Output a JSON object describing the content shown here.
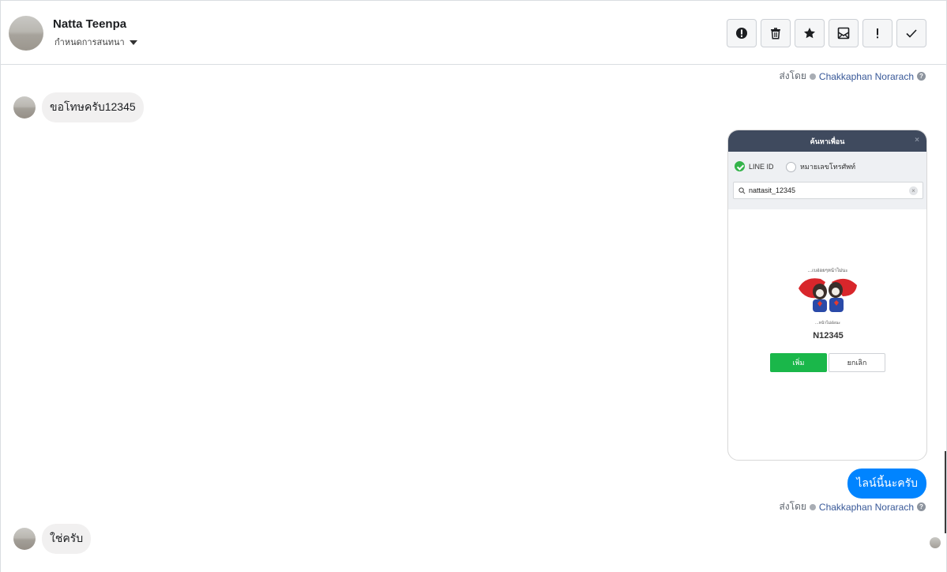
{
  "header": {
    "name": "Natta Teenpa",
    "subtitle": "กำหนดการสนทนา"
  },
  "actions": [
    {
      "name": "spam-button",
      "icon": "alert-circle-icon"
    },
    {
      "name": "delete-button",
      "icon": "trash-icon"
    },
    {
      "name": "star-button",
      "icon": "star-icon"
    },
    {
      "name": "mark-unread-button",
      "icon": "envelope-icon"
    },
    {
      "name": "important-button",
      "icon": "exclamation-icon"
    },
    {
      "name": "done-button",
      "icon": "check-icon"
    }
  ],
  "sent_by": {
    "prefix": "ส่งโดย",
    "agent": "Chakkaphan Norarach",
    "help": "?"
  },
  "messages": {
    "m1": "ขอโทษครับ12345",
    "m2": "ไลน์นี้นะครับ",
    "m3": "ใช่ครับ"
  },
  "card": {
    "title": "ค้นหาเพื่อน",
    "close": "×",
    "option_line_id": "LINE ID",
    "option_phone": "หมายเลขโทรศัพท์",
    "search_value": "nattasit_12345",
    "profile_caption_top": "...เบอ่อยๆหน้าไม่นะ",
    "profile_caption_bottom": "...หน้าไม่อ๋อนะ",
    "profile_name": "N12345",
    "add_label": "เพิ่ม",
    "cancel_label": "ยกเลิก"
  },
  "colors": {
    "accent_blue": "#0084ff",
    "line_green": "#1ab74a",
    "card_header": "#3f4a5e"
  }
}
